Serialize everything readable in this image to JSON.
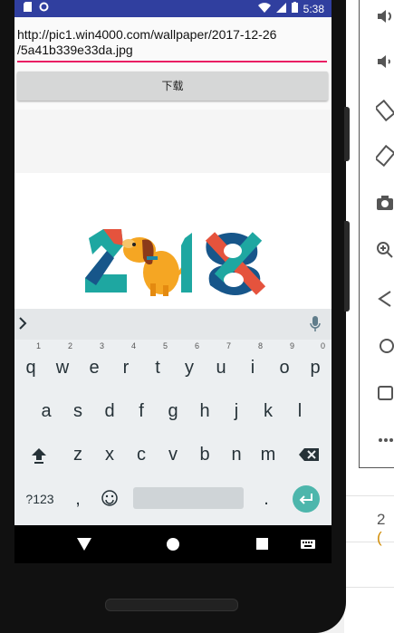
{
  "status_bar": {
    "time": "5:38"
  },
  "url_field": {
    "value": "http://pic1.win4000.com/wallpaper/2017-12-26\n/5a41b339e33da.jpg"
  },
  "download_button": {
    "label": "下载"
  },
  "keyboard": {
    "row1": [
      {
        "key": "q",
        "hint": "1"
      },
      {
        "key": "w",
        "hint": "2"
      },
      {
        "key": "e",
        "hint": "3"
      },
      {
        "key": "r",
        "hint": "4"
      },
      {
        "key": "t",
        "hint": "5"
      },
      {
        "key": "y",
        "hint": "6"
      },
      {
        "key": "u",
        "hint": "7"
      },
      {
        "key": "i",
        "hint": "8"
      },
      {
        "key": "o",
        "hint": "9"
      },
      {
        "key": "p",
        "hint": "0"
      }
    ],
    "row2": [
      "a",
      "s",
      "d",
      "f",
      "g",
      "h",
      "j",
      "k",
      "l"
    ],
    "row3": [
      "z",
      "x",
      "c",
      "v",
      "b",
      "n",
      "m"
    ],
    "symbols_key": "?123",
    "comma_key": ",",
    "period_key": "."
  },
  "background": {
    "number": "2",
    "number_tail": "("
  },
  "colors": {
    "status_bar": "#303f9f",
    "input_underline": "#e91e63",
    "enter_key": "#4db6ac"
  }
}
